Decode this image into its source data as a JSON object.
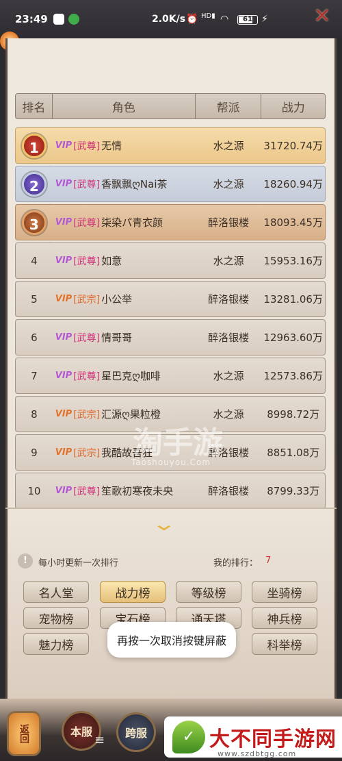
{
  "status_bar": {
    "time": "23:49",
    "network_speed": "2.0K/s",
    "battery": "61"
  },
  "table": {
    "headers": [
      "排名",
      "角色",
      "帮派",
      "战力"
    ],
    "rows": [
      {
        "rank": "1",
        "vip_color": "purple",
        "title": "[武尊]",
        "name": "无情",
        "guild": "水之源",
        "power": "31720.74万"
      },
      {
        "rank": "2",
        "vip_color": "purple",
        "title": "[武尊]",
        "name": "香飘飘ღNai茶",
        "guild": "水之源",
        "power": "18260.94万"
      },
      {
        "rank": "3",
        "vip_color": "purple",
        "title": "[武尊]",
        "name": "柒染パ青衣颜",
        "guild": "醉洛银楼",
        "power": "18093.45万"
      },
      {
        "rank": "4",
        "vip_color": "purple",
        "title": "[武尊]",
        "name": "如意",
        "guild": "水之源",
        "power": "15953.16万"
      },
      {
        "rank": "5",
        "vip_color": "orange",
        "title": "[武宗]",
        "name": "小公举",
        "guild": "醉洛银楼",
        "power": "13281.06万"
      },
      {
        "rank": "6",
        "vip_color": "purple",
        "title": "[武尊]",
        "name": "情哥哥",
        "guild": "醉洛银楼",
        "power": "12963.60万"
      },
      {
        "rank": "7",
        "vip_color": "purple",
        "title": "[武尊]",
        "name": "星巴克ღ咖啡",
        "guild": "水之源",
        "power": "12573.86万"
      },
      {
        "rank": "8",
        "vip_color": "orange",
        "title": "[武宗]",
        "name": "汇源ღ果粒橙",
        "guild": "水之源",
        "power": "8998.72万"
      },
      {
        "rank": "9",
        "vip_color": "orange",
        "title": "[武宗]",
        "name": "我酷故吾狂",
        "guild": "醉洛银楼",
        "power": "8851.08万"
      },
      {
        "rank": "10",
        "vip_color": "purple",
        "title": "[武尊]",
        "name": "笙歌初寒夜未央",
        "guild": "醉洛银楼",
        "power": "8799.33万"
      }
    ],
    "vip_label": "VIP"
  },
  "info": {
    "refresh_text": "每小时更新一次排行",
    "my_rank_label": "我的排行：",
    "my_rank_value": "7"
  },
  "tabs": [
    "名人堂",
    "战力榜",
    "等级榜",
    "坐骑榜",
    "宠物榜",
    "宝石榜",
    "通天塔",
    "神兵榜",
    "魅力榜",
    "科举榜"
  ],
  "active_tab": "战力榜",
  "toast": "再按一次取消按键屏蔽",
  "bottom": {
    "back_label": "返回",
    "server_label": "本服",
    "cross_label": "跨服"
  },
  "watermark": {
    "main": "淘手游",
    "sub": "Taoshouyou.Com"
  },
  "brand": {
    "name": "大不同手游网",
    "url": "www.szdbtgg.com"
  },
  "colors": {
    "panel_bg": "#ece4d9",
    "rank1_bg": "#f4dcaa",
    "rank2_bg": "#d6dce6",
    "rank3_bg": "#e6c9a9",
    "active_tab": "#e5c07a",
    "my_rank_value": "#cc3333"
  }
}
